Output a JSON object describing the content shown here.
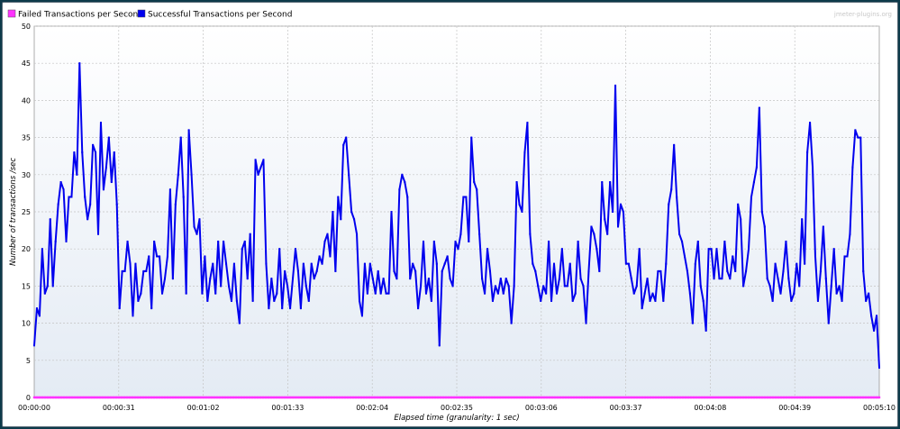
{
  "chart_data": {
    "type": "line",
    "title": "",
    "watermark": "jmeter-plugins.org",
    "xlabel": "Elapsed time (granularity: 1 sec)",
    "ylabel": "Number of transactions /sec",
    "ylim": [
      0,
      50
    ],
    "xlim_seconds": [
      0,
      310
    ],
    "y_ticks": [
      0,
      5,
      10,
      15,
      20,
      25,
      30,
      35,
      40,
      45,
      50
    ],
    "x_ticks": [
      "00:00:00",
      "00:00:31",
      "00:01:02",
      "00:01:33",
      "00:02:04",
      "00:02:35",
      "00:03:06",
      "00:03:37",
      "00:04:08",
      "00:04:39",
      "00:05:10"
    ],
    "grid": true,
    "legend_position": "top-left",
    "series": [
      {
        "name": "Failed Transactions per Second",
        "color": "#ff33ff",
        "x_start": 0,
        "x_end": 310,
        "constant_value": 0
      },
      {
        "name": "Successful Transactions per Second",
        "color": "#0000ee",
        "x_start": 0,
        "x_end": 310,
        "values": [
          7,
          12,
          11,
          20,
          14,
          15,
          24,
          15,
          21,
          26,
          29,
          28,
          21,
          27,
          27,
          33,
          30,
          45,
          33,
          27,
          24,
          26,
          34,
          33,
          22,
          37,
          28,
          31,
          35,
          29,
          33,
          26,
          12,
          17,
          17,
          21,
          18,
          11,
          18,
          13,
          14,
          17,
          17,
          19,
          12,
          21,
          19,
          19,
          14,
          16,
          19,
          28,
          16,
          26,
          30,
          35,
          27,
          14,
          36,
          30,
          23,
          22,
          24,
          14,
          19,
          13,
          16,
          18,
          14,
          21,
          15,
          21,
          18,
          15,
          13,
          18,
          13,
          10,
          20,
          21,
          16,
          22,
          13,
          32,
          30,
          31,
          32,
          18,
          12,
          16,
          13,
          14,
          20,
          12,
          17,
          15,
          12,
          16,
          20,
          17,
          12,
          18,
          15,
          13,
          18,
          16,
          17,
          19,
          18,
          21,
          22,
          19,
          25,
          17,
          27,
          24,
          34,
          35,
          30,
          25,
          24,
          22,
          13,
          11,
          18,
          14,
          18,
          16,
          14,
          17,
          14,
          16,
          14,
          14,
          25,
          17,
          16,
          28,
          30,
          29,
          27,
          16,
          18,
          17,
          12,
          15,
          21,
          14,
          16,
          13,
          21,
          18,
          7,
          17,
          18,
          19,
          16,
          15,
          21,
          20,
          22,
          27,
          27,
          21,
          35,
          29,
          28,
          22,
          16,
          14,
          20,
          17,
          13,
          15,
          14,
          16,
          14,
          16,
          15,
          10,
          15,
          29,
          26,
          25,
          33,
          37,
          22,
          18,
          17,
          15,
          13,
          15,
          14,
          21,
          13,
          18,
          14,
          16,
          20,
          15,
          15,
          18,
          13,
          14,
          21,
          16,
          15,
          10,
          17,
          23,
          22,
          20,
          17,
          29,
          24,
          22,
          29,
          25,
          42,
          23,
          26,
          25,
          18,
          18,
          16,
          14,
          15,
          20,
          12,
          14,
          16,
          13,
          14,
          13,
          17,
          17,
          13,
          18,
          26,
          28,
          34,
          27,
          22,
          21,
          19,
          17,
          14,
          10,
          18,
          21,
          15,
          13,
          9,
          20,
          20,
          16,
          20,
          16,
          16,
          21,
          17,
          16,
          19,
          17,
          26,
          24,
          15,
          17,
          20,
          27,
          29,
          31,
          39,
          25,
          23,
          16,
          15,
          13,
          18,
          16,
          14,
          17,
          21,
          16,
          13,
          14,
          18,
          15,
          24,
          18,
          33,
          37,
          31,
          19,
          13,
          17,
          23,
          16,
          10,
          15,
          20,
          14,
          15,
          13,
          19,
          19,
          22,
          31,
          36,
          35,
          35,
          17,
          13,
          14,
          11,
          9,
          11,
          4
        ]
      }
    ]
  }
}
